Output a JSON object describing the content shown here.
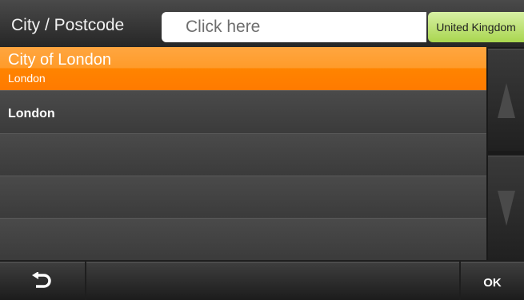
{
  "header": {
    "title": "City / Postcode",
    "search_placeholder": "Click here",
    "country_button": "United Kingdom"
  },
  "results": [
    {
      "name": "City of London",
      "sub": "London",
      "selected": true
    },
    {
      "name": "London",
      "sub": "",
      "selected": false
    },
    {
      "name": "",
      "sub": "",
      "selected": false
    },
    {
      "name": "",
      "sub": "",
      "selected": false
    },
    {
      "name": "",
      "sub": "",
      "selected": false
    }
  ],
  "scrollbar": {
    "up_icon": "arrow-up-icon",
    "down_icon": "arrow-down-icon"
  },
  "footer": {
    "back_icon": "back-arrow-icon",
    "ok_label": "OK"
  },
  "colors": {
    "selected": "#ff8c1a",
    "country_button": "#bfe27a",
    "row": "#424242"
  }
}
